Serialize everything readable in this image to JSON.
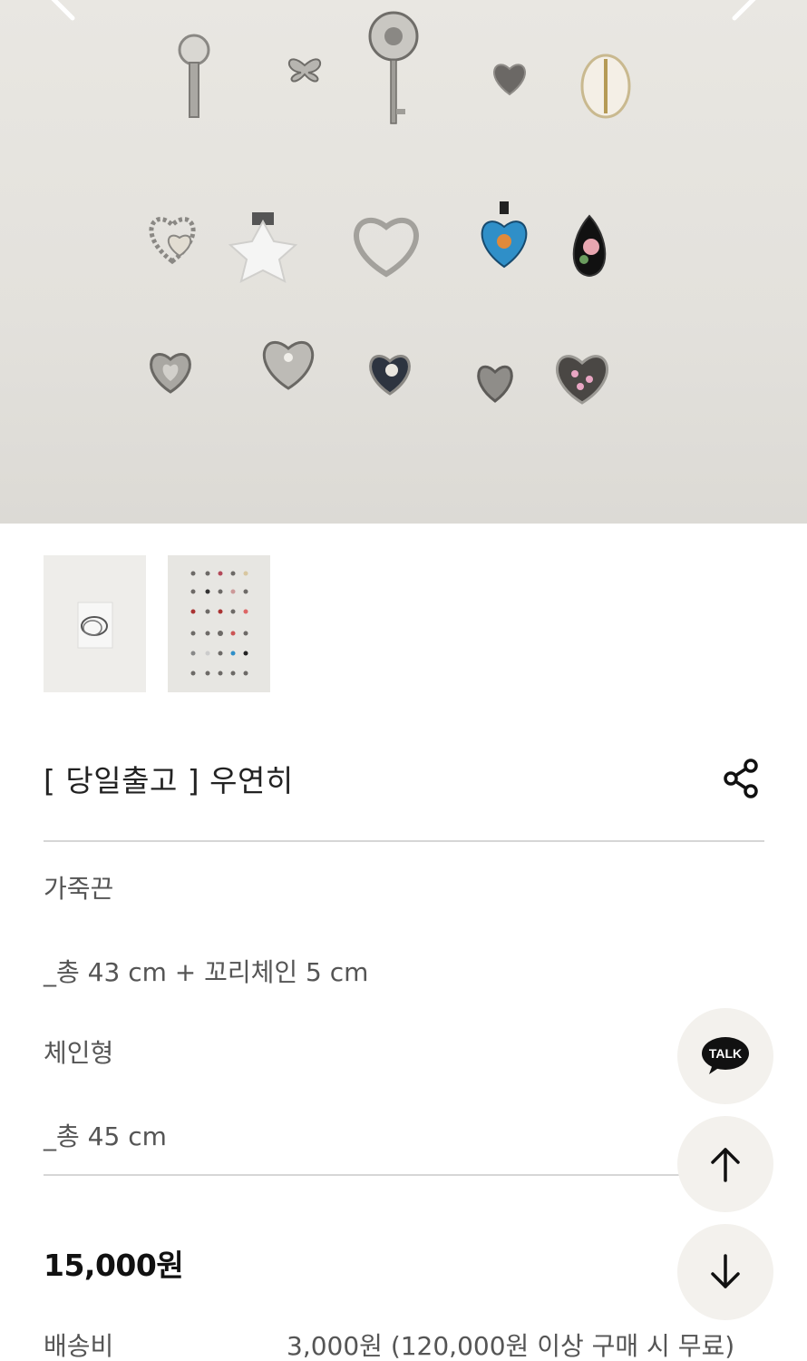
{
  "product": {
    "title": "[ 당일출고 ] 우연히",
    "description": [
      "가죽끈",
      "_총 43 cm + 꼬리체인 5 cm",
      "체인형",
      "_총 45 cm"
    ],
    "price": "15,000원",
    "shipping": {
      "label": "배송비",
      "value": "3,000원 (120,000원 이상 구매 시 무료)"
    }
  },
  "floating_buttons": {
    "talk_label": "TALK"
  },
  "icons": {
    "prev": "chevron-left-icon",
    "next": "chevron-right-icon",
    "share": "share-icon",
    "talk": "kakao-talk-icon",
    "up": "arrow-up-icon",
    "down": "arrow-down-icon"
  },
  "colors": {
    "hero_background": "#e6e4df",
    "divider": "#d6d6d6",
    "fab_background": "#f3f1ed",
    "text_primary": "#222222",
    "text_secondary": "#555555"
  }
}
